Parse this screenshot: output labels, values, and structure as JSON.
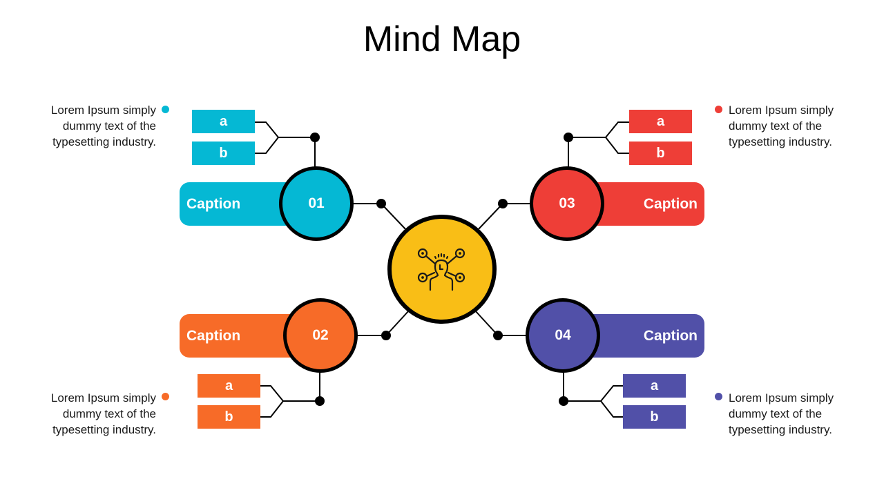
{
  "title": "Mind Map",
  "center": {
    "icon": "mind-network-person-icon",
    "color": "#F9BE16"
  },
  "branches": [
    {
      "number": "01",
      "caption": "Caption",
      "color": "#05B8D4",
      "sub_items": [
        "a",
        "b"
      ],
      "note": "Lorem Ipsum simply dummy text of the typesetting industry."
    },
    {
      "number": "02",
      "caption": "Caption",
      "color": "#F76B28",
      "sub_items": [
        "a",
        "b"
      ],
      "note": "Lorem Ipsum simply dummy text of the typesetting industry."
    },
    {
      "number": "03",
      "caption": "Caption",
      "color": "#EE3E37",
      "sub_items": [
        "a",
        "b"
      ],
      "note": "Lorem Ipsum simply dummy text of the typesetting industry."
    },
    {
      "number": "04",
      "caption": "Caption",
      "color": "#5150A8",
      "sub_items": [
        "a",
        "b"
      ],
      "note": "Lorem Ipsum simply dummy text of the typesetting industry."
    }
  ]
}
